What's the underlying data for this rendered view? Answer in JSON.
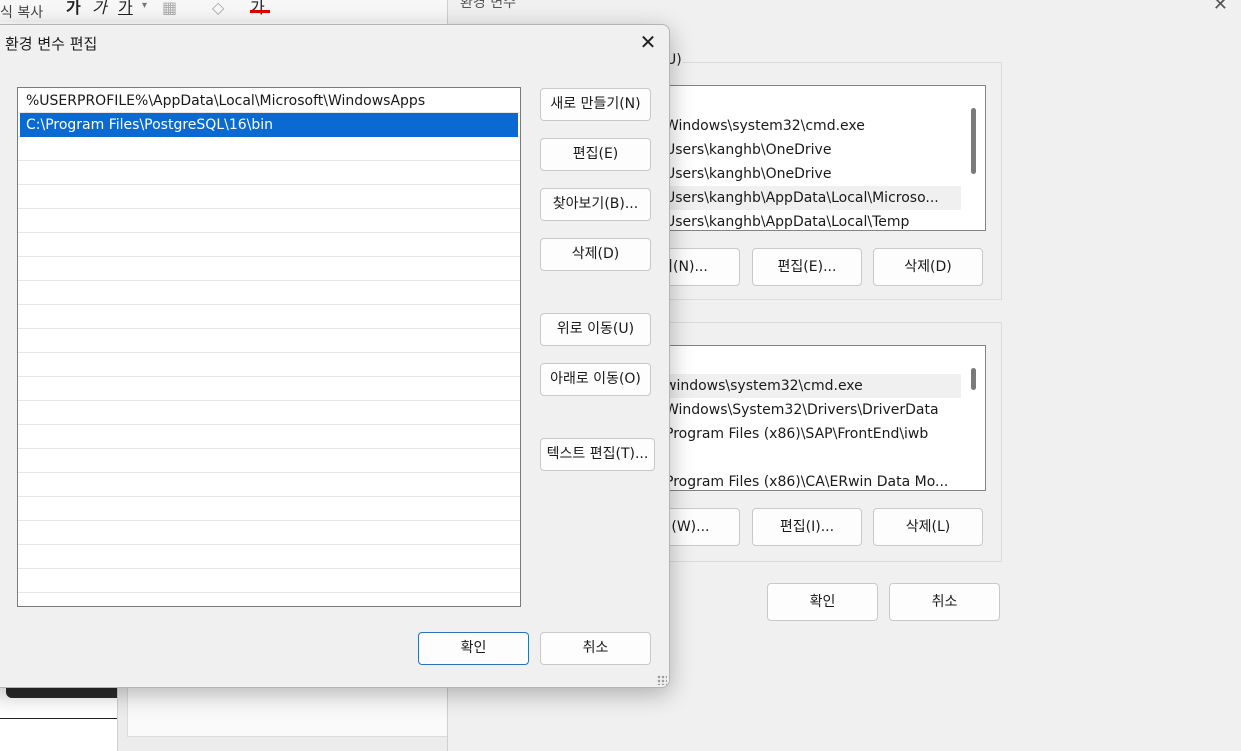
{
  "background_app": {
    "copy_label": "식 복사",
    "fmt_bold": "가",
    "fmt_italic": "가",
    "fmt_underline": "가",
    "fmt_fontcolor": "가"
  },
  "env_window": {
    "title": "환경 변수",
    "user_section_label_fragment": "U)",
    "user_vars_fragments": [
      "Windows\\system32\\cmd.exe",
      "Users\\kanghb\\OneDrive",
      "Users\\kanghb\\OneDrive",
      "Users\\kanghb\\AppData\\Local\\Microso...",
      "Users\\kanghb\\AppData\\Local\\Temp"
    ],
    "user_buttons": {
      "new": "기(N)...",
      "edit": "편집(E)...",
      "delete": "삭제(D)"
    },
    "system_vars_fragments": [
      "windows\\system32\\cmd.exe",
      "Windows\\System32\\Drivers\\DriverData",
      "Program Files (x86)\\SAP\\FrontEnd\\iwb",
      "",
      "Program Files (x86)\\CA\\ERwin Data Mo..."
    ],
    "system_buttons": {
      "new": "기(W)...",
      "edit": "편집(I)...",
      "delete": "삭제(L)"
    },
    "ok": "확인",
    "cancel": "취소"
  },
  "edit_dialog": {
    "title": "환경 변수 편집",
    "paths": [
      "%USERPROFILE%\\AppData\\Local\\Microsoft\\WindowsApps",
      "C:\\Program Files\\PostgreSQL\\16\\bin"
    ],
    "selected_index": 1,
    "buttons": {
      "new": "새로 만들기(N)",
      "edit": "편집(E)",
      "browse": "찾아보기(B)...",
      "delete": "삭제(D)",
      "move_up": "위로 이동(U)",
      "move_down": "아래로 이동(O)",
      "edit_text": "텍스트 편집(T)..."
    },
    "ok": "확인",
    "cancel": "취소"
  }
}
